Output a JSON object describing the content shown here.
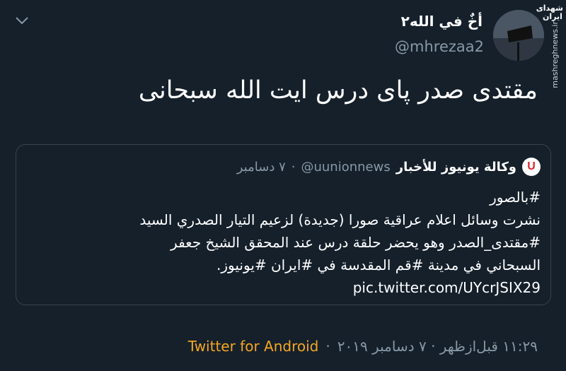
{
  "header": {
    "display_name": "أخٌ في الله٢",
    "handle": "@mhrezaa2"
  },
  "watermark": {
    "brand": "شهدای ایران",
    "site": "mashreghnews.ir"
  },
  "tweet": {
    "text": "مقتدی صدر پای درس ایت الله سبحانی"
  },
  "quoted": {
    "logo_letter": "U",
    "name": "وكالة يونيوز للأخبار",
    "handle": "@uunionnews",
    "separator": "·",
    "date": "٧ دسامبر",
    "lines": [
      "#بالصور",
      "نشرت وسائل اعلام عراقية صورا (جديدة) لزعيم التيار الصدري السيد",
      "#مقتدى_الصدر وهو يحضر حلقة درس عند المحقق الشيخ جعفر",
      "السبحاني في مدينة #قم المقدسة في #ايران #يونيوز."
    ],
    "link": "pic.twitter.com/UYcrJSIX29"
  },
  "footer": {
    "timestamp": "۱۱:۲۹ قبل‌ازظهر · ۷ دسامبر ۲۰۱۹",
    "separator": "·",
    "source": "Twitter for Android"
  },
  "colors": {
    "background": "#15202b",
    "secondary_text": "#8899a6",
    "source_accent": "#f5a623",
    "border": "#38444d"
  }
}
